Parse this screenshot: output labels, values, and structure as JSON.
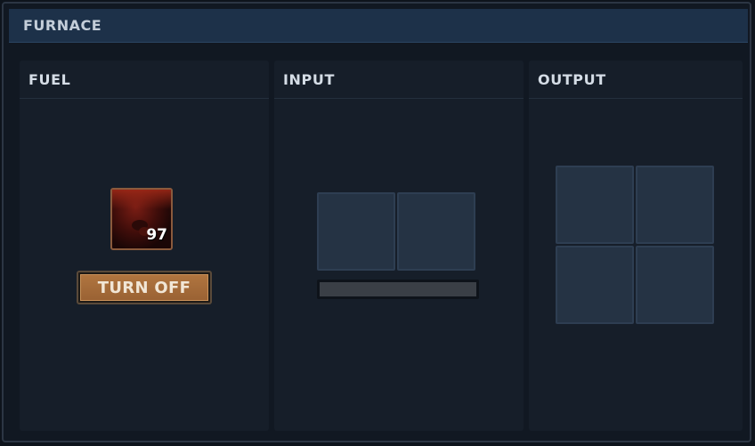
{
  "window": {
    "title": "FURNACE"
  },
  "fuel_panel": {
    "label": "FUEL",
    "slot": {
      "item_icon": "burning-fuel-icon",
      "count": "97"
    },
    "turn_off_label": "TURN OFF"
  },
  "input_panel": {
    "label": "INPUT",
    "slots": [
      {
        "item": null
      },
      {
        "item": null
      }
    ],
    "progress": 0
  },
  "output_panel": {
    "label": "OUTPUT",
    "slots": [
      {
        "item": null
      },
      {
        "item": null
      },
      {
        "item": null
      },
      {
        "item": null
      }
    ]
  },
  "colors": {
    "titlebar": "#1d3149",
    "panel_bg": "#161e29",
    "slot_bg": "#253344",
    "button": "#b0753f",
    "fuel_slot_border": "#8a5a3c"
  }
}
